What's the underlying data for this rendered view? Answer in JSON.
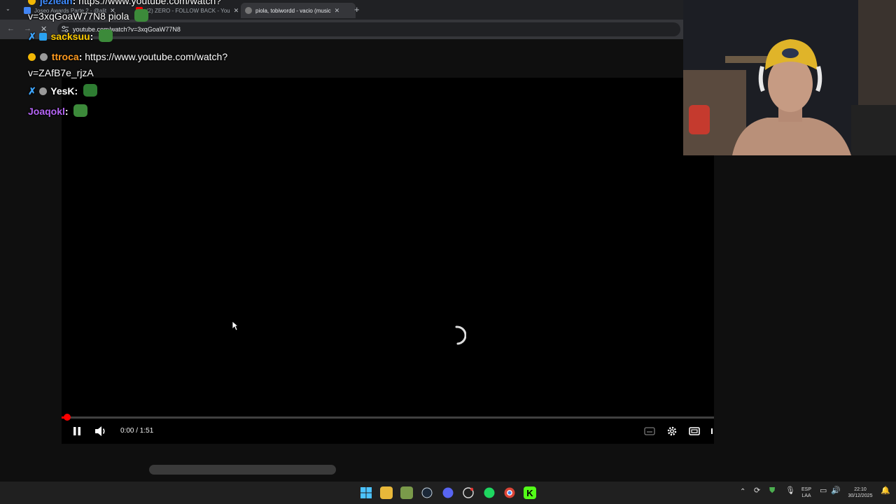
{
  "browser": {
    "tabs": [
      {
        "label": "Joseo Awards Parte 2 - @alit",
        "active": false
      },
      {
        "label": "(2) ZERO - FOLLOW BACK - You",
        "active": false
      },
      {
        "label": "piola, tobiwordd - vacio (music",
        "active": true
      }
    ],
    "new_tab_label": "+",
    "url": "youtube.com/watch?v=3xqGoaW77N8"
  },
  "chat": [
    {
      "user": "jezlean",
      "color": "#3f8cff",
      "text": "https://www.youtube.com/watch?",
      "text2": "v=3xqGoaW77N8 piola"
    },
    {
      "user": "sacksuu",
      "color": "#ffcc00",
      "text": ""
    },
    {
      "user": "ttroca",
      "color": "#ff9a1f",
      "text": "https://www.youtube.com/watch?",
      "text2": "v=ZAfB7e_rjzA"
    },
    {
      "user": "YesK",
      "color": "#ffffff",
      "text": ""
    },
    {
      "user": "Joaqokl",
      "color": "#b565f5",
      "text": ""
    }
  ],
  "player": {
    "time_display": "0:00 / 1:51",
    "progress": 0.004,
    "state": "loading"
  },
  "taskbar": {
    "language_line1": "ESP",
    "language_line2": "LAA",
    "clock_time": "22:10",
    "clock_date": "30/12/2025"
  },
  "colors": {
    "youtube_red": "#ff0000",
    "taskbar_bg": "#202020",
    "browser_bg": "#202124"
  }
}
